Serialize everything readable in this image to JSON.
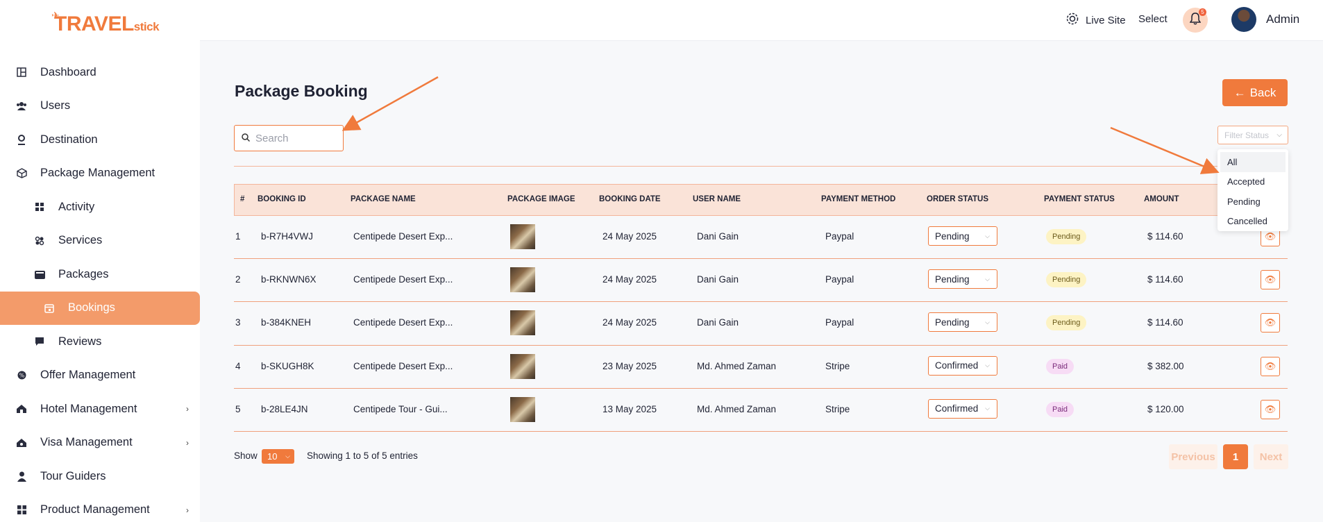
{
  "brand": {
    "logo_part1": "TRAVEL",
    "logo_part2": "stick"
  },
  "sidebar": {
    "items": [
      {
        "label": "Dashboard",
        "icon": "dashboard-icon"
      },
      {
        "label": "Users",
        "icon": "users-icon"
      },
      {
        "label": "Destination",
        "icon": "location-pin-icon"
      },
      {
        "label": "Package Management",
        "icon": "package-icon"
      },
      {
        "label": "Activity",
        "icon": "grid-icon"
      },
      {
        "label": "Services",
        "icon": "services-icon"
      },
      {
        "label": "Packages",
        "icon": "wallet-icon"
      },
      {
        "label": "Bookings",
        "icon": "calendar-icon"
      },
      {
        "label": "Reviews",
        "icon": "chat-icon"
      },
      {
        "label": "Offer Management",
        "icon": "offer-icon"
      },
      {
        "label": "Hotel Management",
        "icon": "hotel-icon"
      },
      {
        "label": "Visa Management",
        "icon": "visa-icon"
      },
      {
        "label": "Tour Guiders",
        "icon": "guide-icon"
      },
      {
        "label": "Product Management",
        "icon": "product-icon"
      }
    ]
  },
  "header": {
    "live_site": "Live Site",
    "select": "Select",
    "notification_count": "5",
    "user_name": "Admin"
  },
  "page": {
    "title": "Package Booking",
    "back_label": "Back",
    "search_placeholder": "Search",
    "filter_placeholder": "Filter Status",
    "filter_options": [
      "All",
      "Accepted",
      "Pending",
      "Cancelled"
    ]
  },
  "table": {
    "headers": [
      "#",
      "BOOKING ID",
      "PACKAGE NAME",
      "PACKAGE IMAGE",
      "BOOKING DATE",
      "USER NAME",
      "PAYMENT METHOD",
      "ORDER STATUS",
      "PAYMENT STATUS",
      "AMOUNT"
    ],
    "rows": [
      {
        "n": "1",
        "id": "b-R7H4VWJ",
        "package": "Centipede Desert Exp...",
        "date": "24 May 2025",
        "user": "Dani Gain",
        "method": "Paypal",
        "order_status": "Pending",
        "payment_status": "Pending",
        "amount": "$ 114.60"
      },
      {
        "n": "2",
        "id": "b-RKNWN6X",
        "package": "Centipede Desert Exp...",
        "date": "24 May 2025",
        "user": "Dani Gain",
        "method": "Paypal",
        "order_status": "Pending",
        "payment_status": "Pending",
        "amount": "$ 114.60"
      },
      {
        "n": "3",
        "id": "b-384KNEH",
        "package": "Centipede Desert Exp...",
        "date": "24 May 2025",
        "user": "Dani Gain",
        "method": "Paypal",
        "order_status": "Pending",
        "payment_status": "Pending",
        "amount": "$ 114.60"
      },
      {
        "n": "4",
        "id": "b-SKUGH8K",
        "package": "Centipede Desert Exp...",
        "date": "23 May 2025",
        "user": "Md. Ahmed Zaman",
        "method": "Stripe",
        "order_status": "Confirmed",
        "payment_status": "Paid",
        "amount": "$ 382.00"
      },
      {
        "n": "5",
        "id": "b-28LE4JN",
        "package": "Centipede Tour - Gui...",
        "date": "13 May 2025",
        "user": "Md. Ahmed Zaman",
        "method": "Stripe",
        "order_status": "Confirmed",
        "payment_status": "Paid",
        "amount": "$ 120.00"
      }
    ]
  },
  "footer": {
    "show_label": "Show",
    "page_size": "10",
    "showing_text": "Showing 1 to 5 of 5 entries",
    "prev": "Previous",
    "page": "1",
    "next": "Next"
  },
  "colors": {
    "accent": "#f07a3c",
    "active_nav": "#f39b6a",
    "table_header": "#fae3d8"
  }
}
